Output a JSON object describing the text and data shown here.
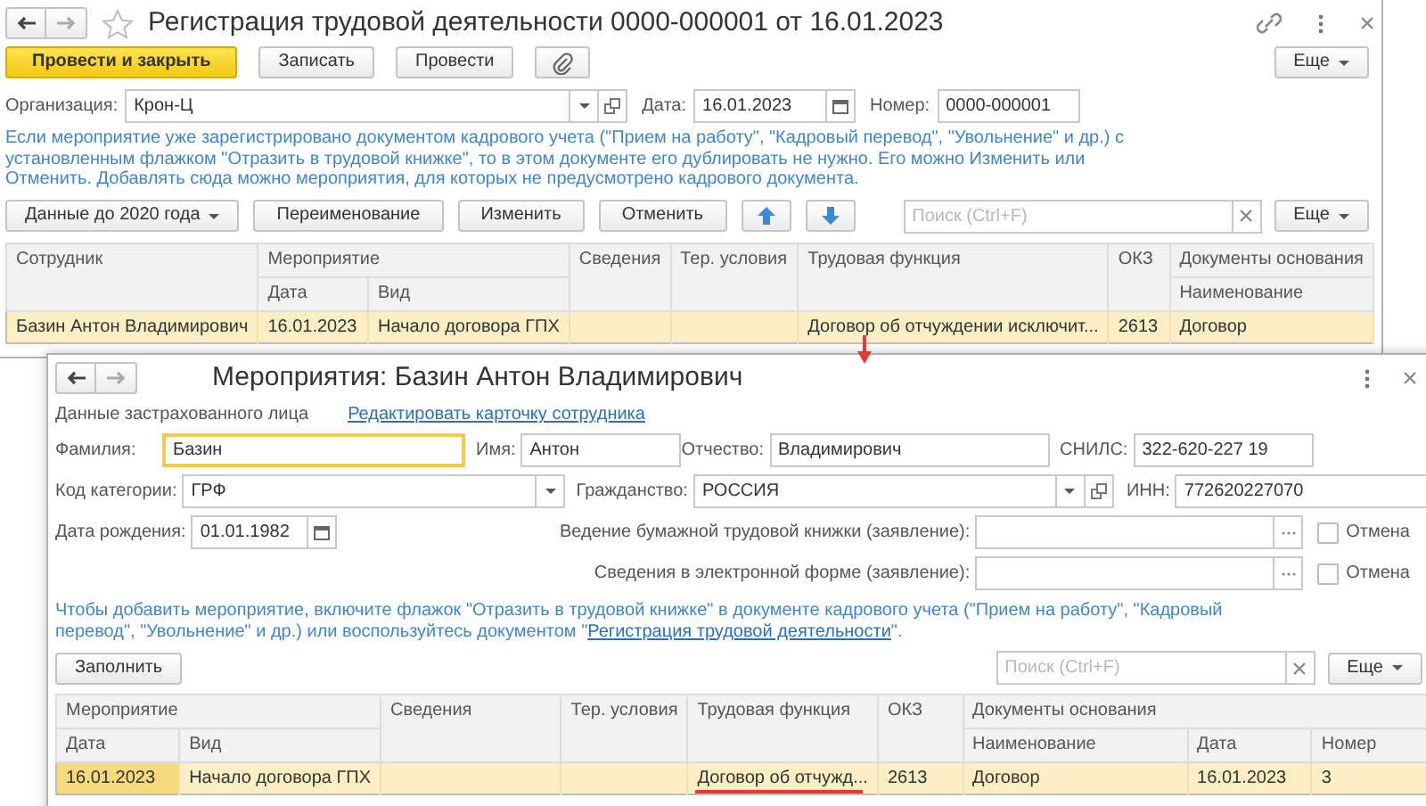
{
  "back_window": {
    "title": "Регистрация трудовой деятельности 0000-000001 от 16.01.2023",
    "favorite": false,
    "buttons": [
      {
        "label": "Провести и закрыть",
        "kind": "primary"
      },
      {
        "label": "Записать",
        "kind": "plain"
      },
      {
        "label": "Провести",
        "kind": "plain"
      },
      {
        "kind": "attach"
      }
    ],
    "more_button": "Еще",
    "organization": {
      "label": "Организация:",
      "value": "Крон-Ц"
    },
    "date": {
      "label": "Дата:",
      "value": "16.01.2023"
    },
    "number": {
      "label": "Номер:",
      "value": "0000-000001"
    },
    "hint": "Если мероприятие уже зарегистрировано документом кадрового учета (\"Прием на работу\", \"Кадровый перевод\", \"Увольнение\" и др.) с установленным флажком \"Отразить в трудовой книжке\", то в этом документе его дублировать не нужно. Его можно Изменить или Отменить. Добавлять сюда можно мероприятия, для которых не предусмотрено кадрового документа.",
    "table_buttons": [
      {
        "label": "Данные до 2020 года",
        "kind": "menu"
      },
      {
        "label": "Переименование",
        "kind": "plain"
      },
      {
        "label": "Изменить",
        "kind": "plain"
      },
      {
        "label": "Отменить",
        "kind": "plain"
      },
      {
        "kind": "move_up"
      },
      {
        "kind": "move_down"
      }
    ],
    "search": {
      "placeholder": "Поиск (Ctrl+F)"
    },
    "table_more_button": "Еще",
    "table": {
      "columns": [
        {
          "label": "Сотрудник"
        },
        {
          "label": "Мероприятие",
          "colspan": 2,
          "children": [
            {
              "label": "Дата"
            },
            {
              "label": "Вид"
            }
          ]
        },
        {
          "label": "Сведения"
        },
        {
          "label": "Тер. условия"
        },
        {
          "label": "Трудовая функция"
        },
        {
          "label": "ОКЗ"
        },
        {
          "label": "Документы основания",
          "children": [
            {
              "label": "Наименование"
            }
          ]
        }
      ],
      "rows": [
        {
          "selected": true,
          "cells": [
            {
              "text": "Базин Антон Владимирович"
            },
            {
              "text": "16.01.2023"
            },
            {
              "text": "Начало договора ГПХ"
            },
            {},
            {},
            {
              "text": "Договор об отчуждении исключит..."
            },
            {
              "text": "2613"
            },
            {
              "text": "Договор"
            }
          ]
        }
      ]
    }
  },
  "front_window": {
    "title": "Мероприятия: Базин Антон Владимирович",
    "section": {
      "label": "Данные застрахованного лица",
      "link": "Редактировать карточку сотрудника"
    },
    "surname": {
      "label": "Фамилия:",
      "value": "Базин",
      "focused": true
    },
    "first_name": {
      "label": "Имя:",
      "value": "Антон",
      "focused": false
    },
    "patronymic": {
      "label": "Отчество:",
      "value": "Владимирович",
      "focused": false
    },
    "snils": {
      "label": "СНИЛС:",
      "value": "322-620-227 19",
      "focused": false
    },
    "category": {
      "label": "Код категории:",
      "value": "ГРФ"
    },
    "citizenship": {
      "label": "Гражданство:",
      "value": "РОССИЯ"
    },
    "inn": {
      "label": "ИНН:",
      "value": "772620227070"
    },
    "birth_date": {
      "label": "Дата рождения:",
      "value": "01.01.1982"
    },
    "statements": [
      {
        "label": "Ведение бумажной трудовой книжки (заявление):",
        "checkbox_label": "Отмена",
        "checked": false
      },
      {
        "label": "Сведения в электронной форме (заявление):",
        "checkbox_label": "Отмена",
        "checked": false
      }
    ],
    "hint": {
      "before": "Чтобы добавить мероприятие, включите флажок \"Отразить в трудовой книжке\" в документе кадрового учета (\"Прием на работу\", \"Кадровый перевод\", \"Увольнение\" и др.) или воспользуйтесь документом \"",
      "link": "Регистрация трудовой деятельности",
      "after": "\"."
    },
    "fill_button": "Заполнить",
    "search": {
      "placeholder": "Поиск (Ctrl+F)"
    },
    "more_button": "Еще",
    "table": {
      "columns": [
        {
          "label": "Мероприятие",
          "colspan": 2,
          "children": [
            {
              "label": "Дата"
            },
            {
              "label": "Вид"
            }
          ]
        },
        {
          "label": "Сведения"
        },
        {
          "label": "Тер. условия"
        },
        {
          "label": "Трудовая функция"
        },
        {
          "label": "ОКЗ"
        },
        {
          "label": "Документы основания",
          "colspan": 3,
          "children": [
            {
              "label": "Наименование"
            },
            {
              "label": "Дата"
            },
            {
              "label": "Номер"
            }
          ]
        }
      ],
      "rows": [
        {
          "selected": true,
          "cells": [
            {
              "text": "16.01.2023",
              "current": true
            },
            {
              "text": "Начало договора ГПХ"
            },
            {},
            {},
            {
              "text": "Договор об отчужд...",
              "underlined": true
            },
            {
              "text": "2613"
            },
            {
              "text": "Договор"
            },
            {
              "text": "16.01.2023"
            },
            {
              "text": "3"
            }
          ]
        }
      ]
    }
  },
  "annotation_arrow": true
}
